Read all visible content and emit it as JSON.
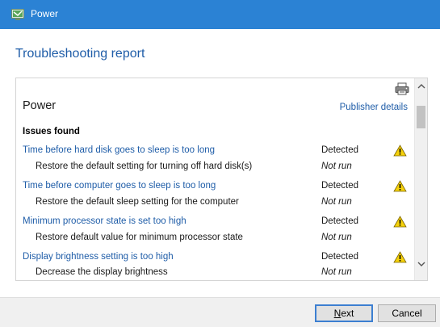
{
  "window": {
    "title": "Power",
    "titlebar_color": "#2b82d4",
    "app_icon": "troubleshooter-icon"
  },
  "page": {
    "heading": "Troubleshooting report"
  },
  "report": {
    "title": "Power",
    "publisher_link": "Publisher details",
    "print_icon": "printer-icon",
    "issues_label": "Issues found",
    "issues": [
      {
        "title": "Time before hard disk goes to sleep is too long",
        "status": "Detected",
        "fix": "Restore the default setting for turning off hard disk(s)",
        "fix_status": "Not run"
      },
      {
        "title": "Time before computer goes to sleep is too long",
        "status": "Detected",
        "fix": "Restore the default sleep setting for the computer",
        "fix_status": "Not run"
      },
      {
        "title": "Minimum processor state is set too high",
        "status": "Detected",
        "fix": "Restore default value for minimum processor state",
        "fix_status": "Not run"
      },
      {
        "title": "Display brightness setting is too high",
        "status": "Detected",
        "fix": "Decrease the display brightness",
        "fix_status": "Not run"
      }
    ]
  },
  "footer": {
    "next_label_accel": "N",
    "next_label_rest": "ext",
    "cancel_label": "Cancel"
  }
}
